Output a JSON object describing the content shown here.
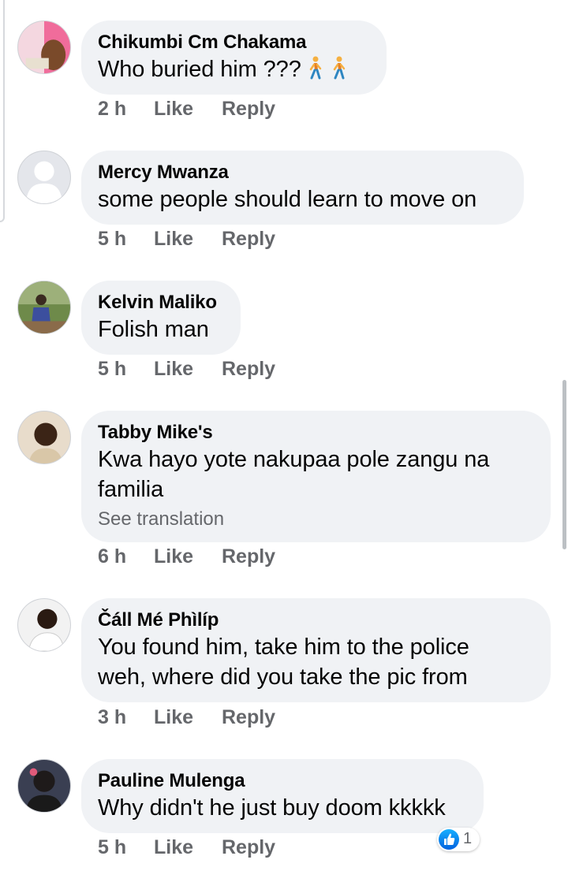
{
  "comments": [
    {
      "author": "Chikumbi Cm Chakama",
      "text": "Who buried him ???",
      "emoji": [
        "person-walking-icon",
        "person-walking-icon"
      ],
      "time": "2 h",
      "like_label": "Like",
      "reply_label": "Reply"
    },
    {
      "author": "Mercy Mwanza",
      "text": "some people should learn to move on",
      "time": "5 h",
      "like_label": "Like",
      "reply_label": "Reply"
    },
    {
      "author": "Kelvin Maliko",
      "text": "Folish man",
      "time": "5 h",
      "like_label": "Like",
      "reply_label": "Reply"
    },
    {
      "author": "Tabby Mike's",
      "text": "Kwa hayo yote nakupaa pole zangu na familia",
      "see_translation": "See translation",
      "time": "6 h",
      "like_label": "Like",
      "reply_label": "Reply"
    },
    {
      "author": "Čáll Mé Phìlíp",
      "text": "You found him, take him to the police weh, where did you take the pic from",
      "time": "3 h",
      "like_label": "Like",
      "reply_label": "Reply"
    },
    {
      "author": "Pauline Mulenga",
      "text": "Why didn't he just buy doom kkkkk",
      "time": "5 h",
      "like_label": "Like",
      "reply_label": "Reply",
      "reaction": {
        "icon": "thumbs-up-icon",
        "count": "1"
      }
    }
  ],
  "colors": {
    "bubble": "#f0f2f5",
    "secondary_text": "#65676b",
    "like_blue": "#1877f2"
  }
}
